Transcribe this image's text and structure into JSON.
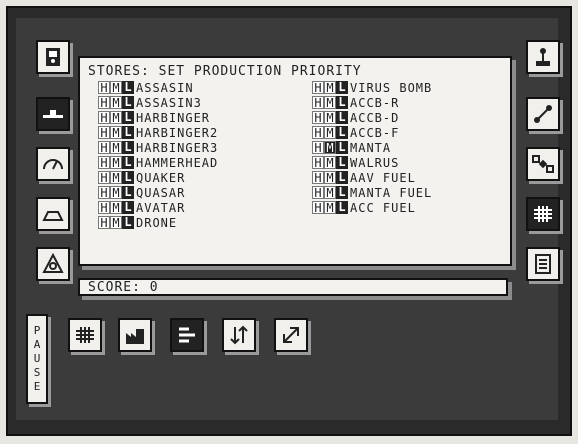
{
  "panel": {
    "title": "STORES: SET PRODUCTION PRIORITY",
    "col_left": [
      {
        "h": "H",
        "m": "M",
        "l": "L",
        "name": "ASSASIN"
      },
      {
        "h": "H",
        "m": "M",
        "l": "L",
        "name": "ASSASIN3"
      },
      {
        "h": "H",
        "m": "M",
        "l": "L",
        "name": "HARBINGER"
      },
      {
        "h": "H",
        "m": "M",
        "l": "L",
        "name": "HARBINGER2"
      },
      {
        "h": "H",
        "m": "M",
        "l": "L",
        "name": "HARBINGER3"
      },
      {
        "h": "H",
        "m": "M",
        "l": "L",
        "name": "HAMMERHEAD"
      },
      {
        "h": "H",
        "m": "M",
        "l": "L",
        "name": "QUAKER"
      },
      {
        "h": "H",
        "m": "M",
        "l": "L",
        "name": "QUASAR"
      },
      {
        "h": "H",
        "m": "M",
        "l": "L",
        "name": "AVATAR"
      },
      {
        "h": "H",
        "m": "M",
        "l": "L",
        "name": "DRONE"
      }
    ],
    "col_right": [
      {
        "h": "H",
        "m": "M",
        "l": "L",
        "name": "VIRUS BOMB"
      },
      {
        "h": "H",
        "m": "M",
        "l": "L",
        "name": "ACCB-R"
      },
      {
        "h": "H",
        "m": "M",
        "l": "L",
        "name": "ACCB-D"
      },
      {
        "h": "H",
        "m": "M",
        "l": "L",
        "name": "ACCB-F"
      },
      {
        "h": "H",
        "m": "M",
        "l": "L",
        "name": "MANTA"
      },
      {
        "h": "H",
        "m": "M",
        "l": "L",
        "name": "WALRUS"
      },
      {
        "h": "H",
        "m": "M",
        "l": "L",
        "name": "AAV FUEL"
      },
      {
        "h": "H",
        "m": "M",
        "l": "L",
        "name": "MANTA FUEL"
      },
      {
        "h": "H",
        "m": "M",
        "l": "L",
        "name": "ACC FUEL"
      }
    ]
  },
  "score": {
    "text": "SCORE: 0"
  },
  "pause": {
    "letters": [
      "P",
      "A",
      "U",
      "S",
      "E"
    ]
  },
  "colors": {
    "ink": "#222222",
    "paper": "#f3f2ee",
    "frame": "#2a2a2a"
  }
}
